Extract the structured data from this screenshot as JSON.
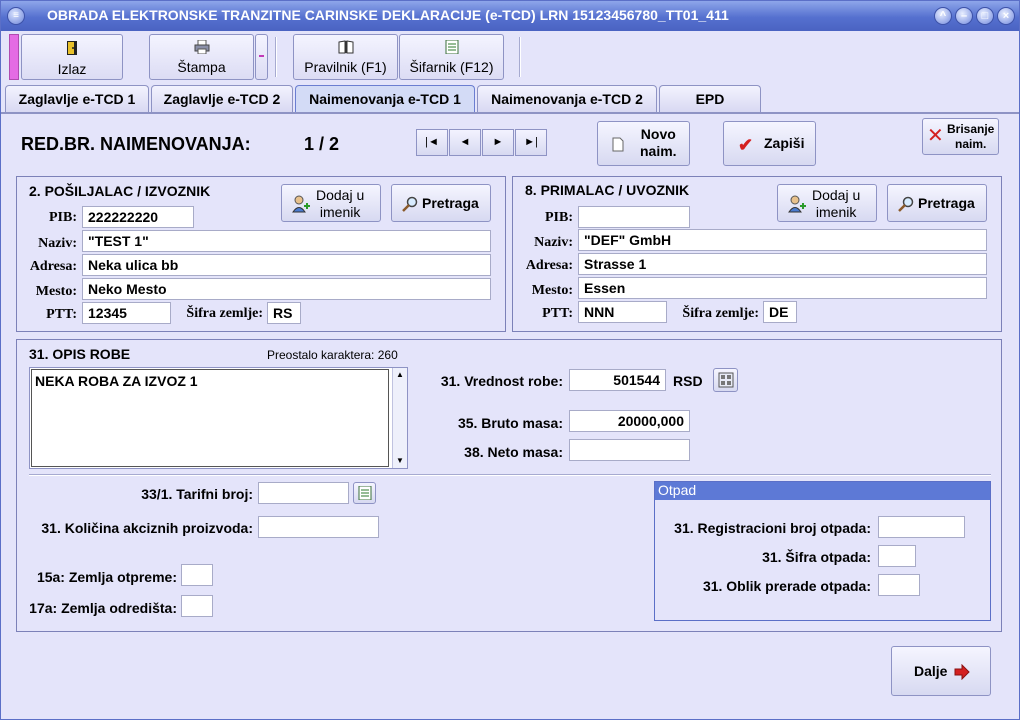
{
  "window": {
    "title": "OBRADA ELEKTRONSKE TRANZITNE CARINSKE DEKLARACIJE (e-TCD)  LRN 15123456780_TT01_411"
  },
  "toolbar": {
    "exit_label": "Izlaz",
    "print_label": "Štampa",
    "rules_label": "Pravilnik (F1)",
    "codes_label": "Šifarnik (F12)"
  },
  "tabs": [
    {
      "label": "Zaglavlje e-TCD 1"
    },
    {
      "label": "Zaglavlje e-TCD 2"
    },
    {
      "label": "Naimenovanja e-TCD 1"
    },
    {
      "label": "Naimenovanja e-TCD 2"
    },
    {
      "label": "EPD"
    }
  ],
  "record": {
    "label": "RED.BR. NAIMENOVANJA:",
    "value": "1 / 2",
    "new_label_1": "Novo",
    "new_label_2": "naim.",
    "save_label": "Zapiši",
    "delete_label_1": "Brisanje",
    "delete_label_2": "naim."
  },
  "sender": {
    "title": "2. POŠILJALAC / IZVOZNIK",
    "add_label_1": "Dodaj u",
    "add_label_2": "imenik",
    "search_label": "Pretraga",
    "pib_label": "PIB:",
    "pib": "222222220",
    "name_label": "Naziv:",
    "name": "\"TEST 1\"",
    "address_label": "Adresa:",
    "address": "Neka ulica bb",
    "city_label": "Mesto:",
    "city": "Neko Mesto",
    "ptt_label": "PTT:",
    "ptt": "12345",
    "country_label": "Šifra zemlje:",
    "country": "RS"
  },
  "receiver": {
    "title": "8. PRIMALAC / UVOZNIK",
    "add_label_1": "Dodaj u",
    "add_label_2": "imenik",
    "search_label": "Pretraga",
    "pib_label": "PIB:",
    "pib": "",
    "name_label": "Naziv:",
    "name": "\"DEF\" GmbH",
    "address_label": "Adresa:",
    "address": "Strasse 1",
    "city_label": "Mesto:",
    "city": "Essen",
    "ptt_label": "PTT:",
    "ptt": "NNN",
    "country_label": "Šifra zemlje:",
    "country": "DE"
  },
  "goods": {
    "title": "31. OPIS ROBE",
    "remaining": "Preostalo karaktera: 260",
    "description": "NEKA ROBA ZA IZVOZ 1",
    "value_label": "31. Vrednost robe:",
    "value": "501544",
    "currency": "RSD",
    "gross_label": "35. Bruto masa:",
    "gross": "20000,000",
    "net_label": "38. Neto masa:",
    "net": "",
    "tariff_label": "33/1. Tarifni broj:",
    "tariff": "",
    "excise_label": "31. Količina akciznih proizvoda:",
    "excise": "",
    "dispatch_label": "15a: Zemlja otpreme:",
    "dispatch": "",
    "destination_label": "17a: Zemlja odredišta:",
    "destination": ""
  },
  "waste": {
    "title": "Otpad",
    "reg_label": "31. Registracioni broj otpada:",
    "reg": "",
    "code_label": "31. Šifra otpada:",
    "code": "",
    "form_label": "31. Oblik prerade otpada:",
    "form": ""
  },
  "footer": {
    "next_label": "Dalje"
  },
  "colors": {
    "titlebar": "#5570cf",
    "background": "#e4e4fa",
    "accent_red": "#d42020"
  }
}
